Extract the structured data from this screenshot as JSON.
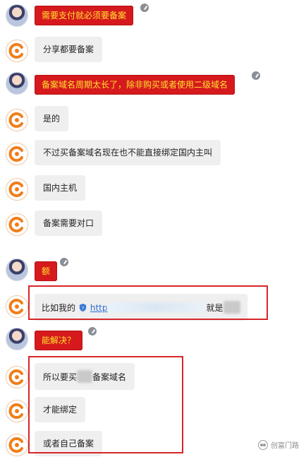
{
  "messages": [
    {
      "from": "user",
      "text": "需要支付就必须要备案"
    },
    {
      "from": "bot",
      "text": "分享都要备案"
    },
    {
      "from": "user",
      "text": "备案域名周期太长了，除非购买或者使用二级域名"
    },
    {
      "from": "bot",
      "text": "是的"
    },
    {
      "from": "bot",
      "text": "不过买备案域名现在也不能直接绑定国内主叫"
    },
    {
      "from": "bot",
      "text": "国内主机"
    },
    {
      "from": "bot",
      "text": "备案需要对口"
    },
    {
      "from": "user",
      "text": "额"
    },
    {
      "from": "bot",
      "prefix": "比如我的",
      "link": "http",
      "suffix": "就是"
    },
    {
      "from": "user",
      "text": "能解决？"
    },
    {
      "from": "bot",
      "prefix": "所以要买",
      "suffix": "备案域名"
    },
    {
      "from": "bot",
      "text": "才能绑定"
    },
    {
      "from": "bot",
      "text": "或者自己备案"
    }
  ],
  "watermark": "创富门路",
  "colors": {
    "user_bubble": "#d6191c",
    "user_text": "#ffe12e",
    "bot_bubble": "#efefef",
    "highlight": "#d82629"
  }
}
